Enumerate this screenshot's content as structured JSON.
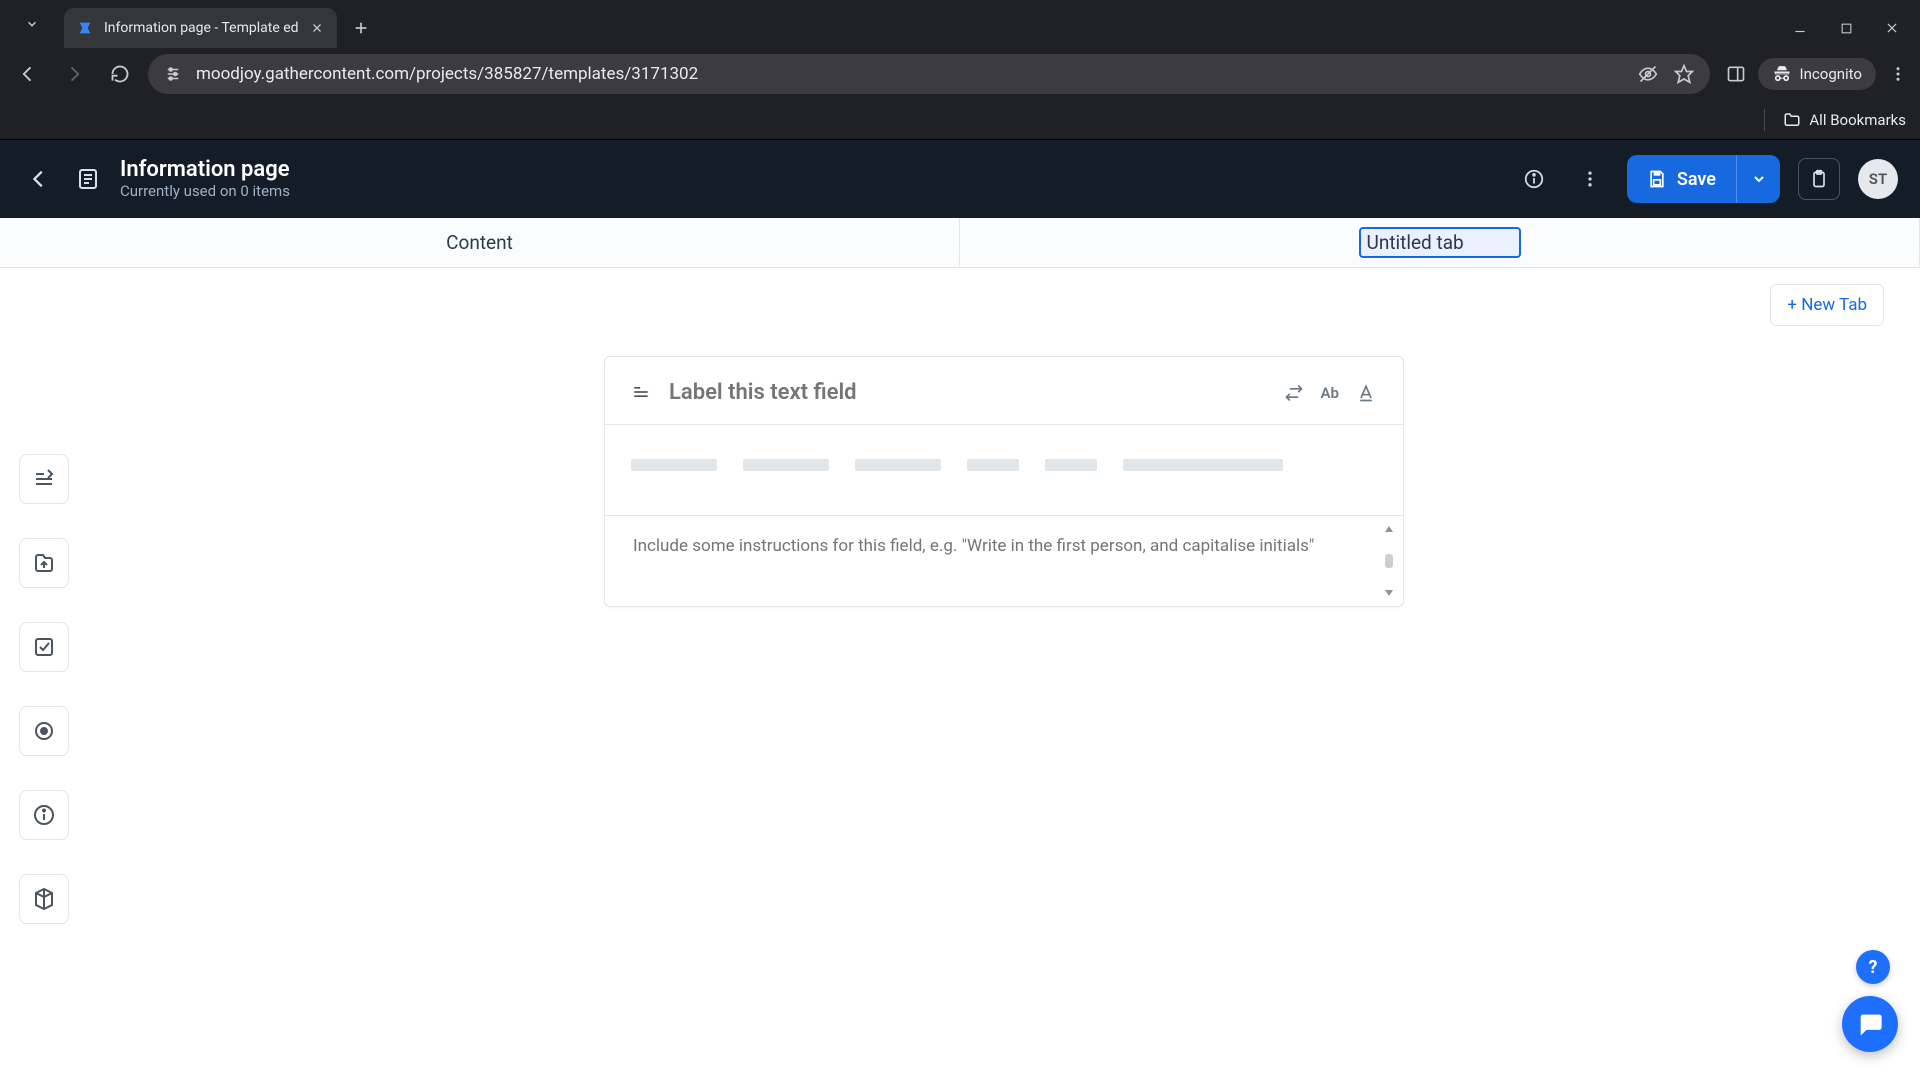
{
  "browser": {
    "tab_title": "Information page - Template ed",
    "url": "moodjoy.gathercontent.com/projects/385827/templates/3171302",
    "incognito_label": "Incognito",
    "bookmarks_label": "All Bookmarks"
  },
  "header": {
    "page_title": "Information page",
    "subtitle": "Currently used on 0 items",
    "save_label": "Save",
    "avatar_initials": "ST"
  },
  "tabs": {
    "items": [
      {
        "label": "Content"
      },
      {
        "label": "Untitled tab"
      }
    ],
    "new_tab_label": "+ New Tab"
  },
  "field_card": {
    "label_placeholder": "Label this text field",
    "ab_label": "Ab",
    "instructions_placeholder": "Include some instructions for this field, e.g. \"Write in the first person, and capitalise initials\"",
    "skeleton_widths": [
      86,
      86,
      86,
      52,
      52,
      160
    ]
  },
  "help": {
    "badge_text": "?"
  },
  "left_rail": {
    "tools": [
      "text-field",
      "attachment",
      "checkbox",
      "radio",
      "guidelines",
      "component"
    ]
  }
}
